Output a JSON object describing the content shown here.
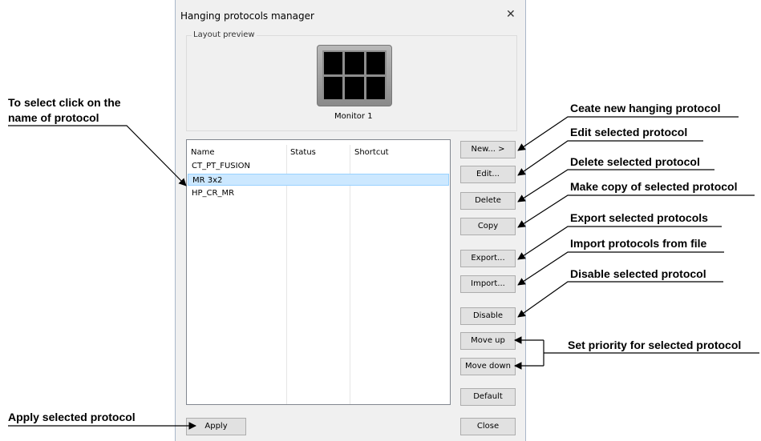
{
  "dialog": {
    "title": "Hanging protocols manager",
    "close": "✕",
    "layout_preview": {
      "legend": "Layout preview",
      "monitor_label": "Monitor 1"
    },
    "table": {
      "columns": [
        "Name",
        "Status",
        "Shortcut"
      ],
      "rows": [
        {
          "name": "CT_PT_FUSION",
          "status": "",
          "shortcut": ""
        },
        {
          "name": "MR 3x2",
          "status": "",
          "shortcut": ""
        },
        {
          "name": "HP_CR_MR",
          "status": "",
          "shortcut": ""
        }
      ],
      "selected_row_index": 1
    },
    "buttons": {
      "new": "New...     >",
      "edit": "Edit...",
      "delete": "Delete",
      "copy": "Copy",
      "export": "Export...",
      "import": "Import...",
      "disable": "Disable",
      "move_up": "Move up",
      "move_down": "Move down",
      "default": "Default",
      "apply": "Apply",
      "close": "Close"
    }
  },
  "annotations": {
    "select": [
      "To select click on the",
      "name of protocol"
    ],
    "new": "Ceate new hanging protocol",
    "edit": "Edit selected protocol",
    "delete": "Delete selected protocol",
    "copy": "Make copy of selected protocol",
    "export": "Export selected protocols",
    "import": "Import protocols from file",
    "disable": "Disable selected protocol",
    "priority": "Set priority for selected protocol",
    "apply": "Apply selected protocol"
  },
  "colors": {
    "dialog_bg": "#f0f0f0",
    "selection_bg": "#cce8ff",
    "selection_border": "#99d1ff",
    "button_bg": "#e1e1e1"
  }
}
